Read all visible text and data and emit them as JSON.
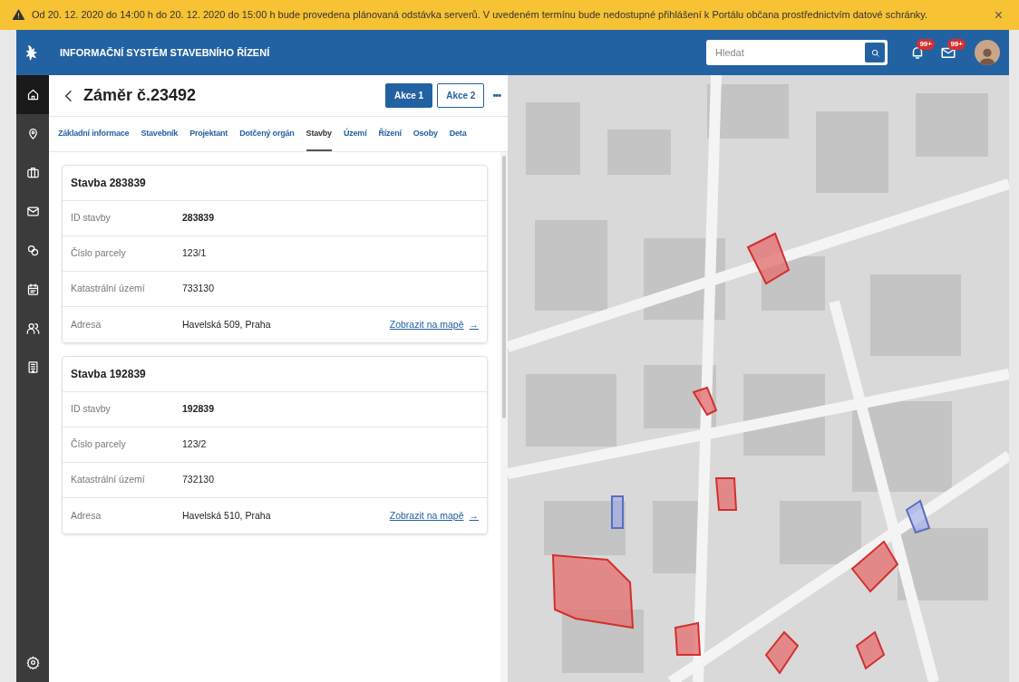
{
  "banner": {
    "text": "Od 20. 12. 2020 do 14:00 h do 20. 12. 2020 do 15:00 h bude provedena plánovaná odstávka serverů. V uvedeném termínu bude nedostupné přihlášení k Portálu občana prostřednictvím datové schránky.",
    "close": "×"
  },
  "header": {
    "title": "INFORMAČNÍ SYSTÉM STAVEBNÍHO ŘÍZENÍ",
    "search": {
      "placeholder": "Hledat"
    },
    "notifications": "99+",
    "messages": "99+"
  },
  "sidebar": {
    "items": [
      {
        "kind": "home",
        "selected": true
      },
      {
        "kind": "pin",
        "selected": false
      },
      {
        "kind": "briefcase",
        "selected": false
      },
      {
        "kind": "mail",
        "selected": false
      },
      {
        "kind": "coins",
        "selected": false
      },
      {
        "kind": "calendar",
        "selected": false
      },
      {
        "kind": "people",
        "selected": false
      },
      {
        "kind": "building",
        "selected": false
      }
    ],
    "bottom": {
      "kind": "settings"
    }
  },
  "detail": {
    "title": "Záměr č.23492",
    "actions": [
      {
        "label": "Akce 1",
        "kind": "primary"
      },
      {
        "label": "Akce 2",
        "kind": "secondary"
      }
    ],
    "more": "•••",
    "tabs": [
      {
        "label": "Základní informace",
        "selected": false
      },
      {
        "label": "Stavebník",
        "selected": false
      },
      {
        "label": "Projektant",
        "selected": false
      },
      {
        "label": "Dotčený orgán",
        "selected": false
      },
      {
        "label": "Stavby",
        "selected": true
      },
      {
        "label": "Území",
        "selected": false
      },
      {
        "label": "Řízení",
        "selected": false
      },
      {
        "label": "Osoby",
        "selected": false
      },
      {
        "label": "Deta",
        "selected": false
      }
    ],
    "cards": [
      {
        "title": "Stavba 283839",
        "rows": [
          {
            "label": "ID stavby",
            "value": "283839",
            "bold": true
          },
          {
            "label": "Číslo parcely",
            "value": "123/1",
            "bold": false
          },
          {
            "label": "Katastrální území",
            "value": "733130",
            "bold": false
          },
          {
            "label": "Adresa",
            "value": "Havelská 509, Praha",
            "bold": false,
            "link": "Zobrazit na mapě",
            "arrow": "→"
          }
        ]
      },
      {
        "title": "Stavba 192839",
        "rows": [
          {
            "label": "ID stavby",
            "value": "192839",
            "bold": true
          },
          {
            "label": "Číslo parcely",
            "value": "123/2",
            "bold": false
          },
          {
            "label": "Katastrální území",
            "value": "732130",
            "bold": false
          },
          {
            "label": "Adresa",
            "value": "Havelská 510, Praha",
            "bold": false,
            "link": "Zobrazit na mapě",
            "arrow": "→"
          }
        ]
      }
    ]
  }
}
